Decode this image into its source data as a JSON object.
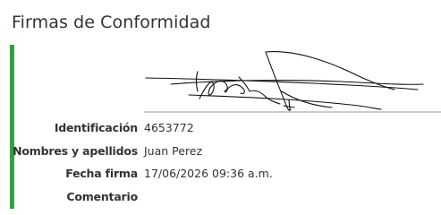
{
  "section": {
    "title": "Firmas de Conformidad",
    "accent_color": "#2ea43c"
  },
  "signature": {
    "icon": "handwritten-signature"
  },
  "fields": {
    "identificacion": {
      "label": "Identificación",
      "value": "4653772"
    },
    "nombres": {
      "label": "Nombres y apellidos",
      "value": "Juan Perez"
    },
    "fecha": {
      "label": "Fecha firma",
      "value": "17/06/2026 09:36 a.m."
    },
    "comentario": {
      "label": "Comentario",
      "value": ""
    }
  }
}
